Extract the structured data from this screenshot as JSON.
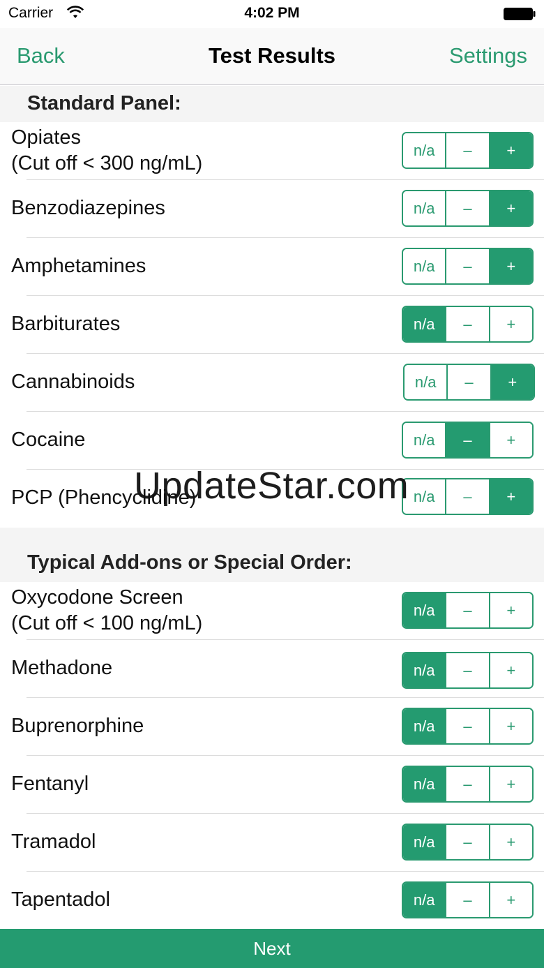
{
  "status": {
    "carrier": "Carrier",
    "time": "4:02 PM"
  },
  "nav": {
    "back": "Back",
    "title": "Test Results",
    "settings": "Settings"
  },
  "segment_labels": [
    "n/a",
    "–",
    "+"
  ],
  "sections": [
    {
      "title": "Standard Panel:",
      "rows": [
        {
          "label": "Opiates",
          "sub": "(Cut off < 300 ng/mL)",
          "selected": "+"
        },
        {
          "label": "Benzodiazepines",
          "selected": "+"
        },
        {
          "label": "Amphetamines",
          "selected": "+"
        },
        {
          "label": "Barbiturates",
          "selected": "n/a"
        },
        {
          "label": "Cannabinoids",
          "selected": "+"
        },
        {
          "label": "Cocaine",
          "selected": "–"
        },
        {
          "label": "PCP (Phencyclidine)",
          "selected": "+"
        }
      ]
    },
    {
      "title": "Typical Add-ons or Special Order:",
      "rows": [
        {
          "label": "Oxycodone Screen",
          "sub": "(Cut off < 100 ng/mL)",
          "selected": "n/a"
        },
        {
          "label": "Methadone",
          "selected": "n/a"
        },
        {
          "label": "Buprenorphine",
          "selected": "n/a"
        },
        {
          "label": "Fentanyl",
          "selected": "n/a"
        },
        {
          "label": "Tramadol",
          "selected": "n/a"
        },
        {
          "label": "Tapentadol",
          "selected": "n/a"
        }
      ]
    }
  ],
  "watermark": "UpdateStar.com",
  "footer": {
    "next": "Next"
  },
  "colors": {
    "accent": "#249b70"
  }
}
